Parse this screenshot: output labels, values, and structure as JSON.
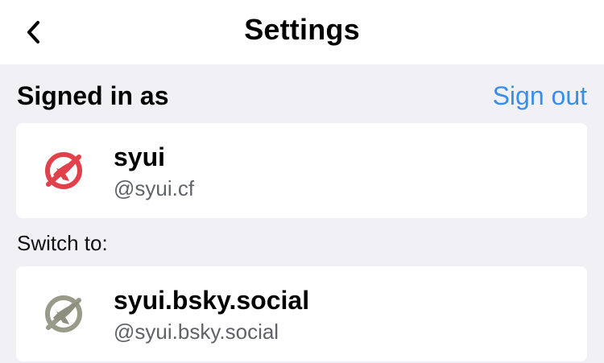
{
  "header": {
    "title": "Settings"
  },
  "signed_in": {
    "label": "Signed in as",
    "sign_out_label": "Sign out",
    "account": {
      "name": "syui",
      "handle": "@syui.cf",
      "avatar_icon": "red-crossed-circle-bird-icon",
      "avatar_color": "#e0414b"
    }
  },
  "switch_to": {
    "label": "Switch to:",
    "accounts": [
      {
        "name": "syui.bsky.social",
        "handle": "@syui.bsky.social",
        "avatar_icon": "gray-crossed-circle-bird-icon",
        "avatar_color": "#9a9a8a"
      }
    ]
  },
  "colors": {
    "accent": "#3b8ee8",
    "background": "#f1f1f5",
    "card": "#ffffff"
  }
}
